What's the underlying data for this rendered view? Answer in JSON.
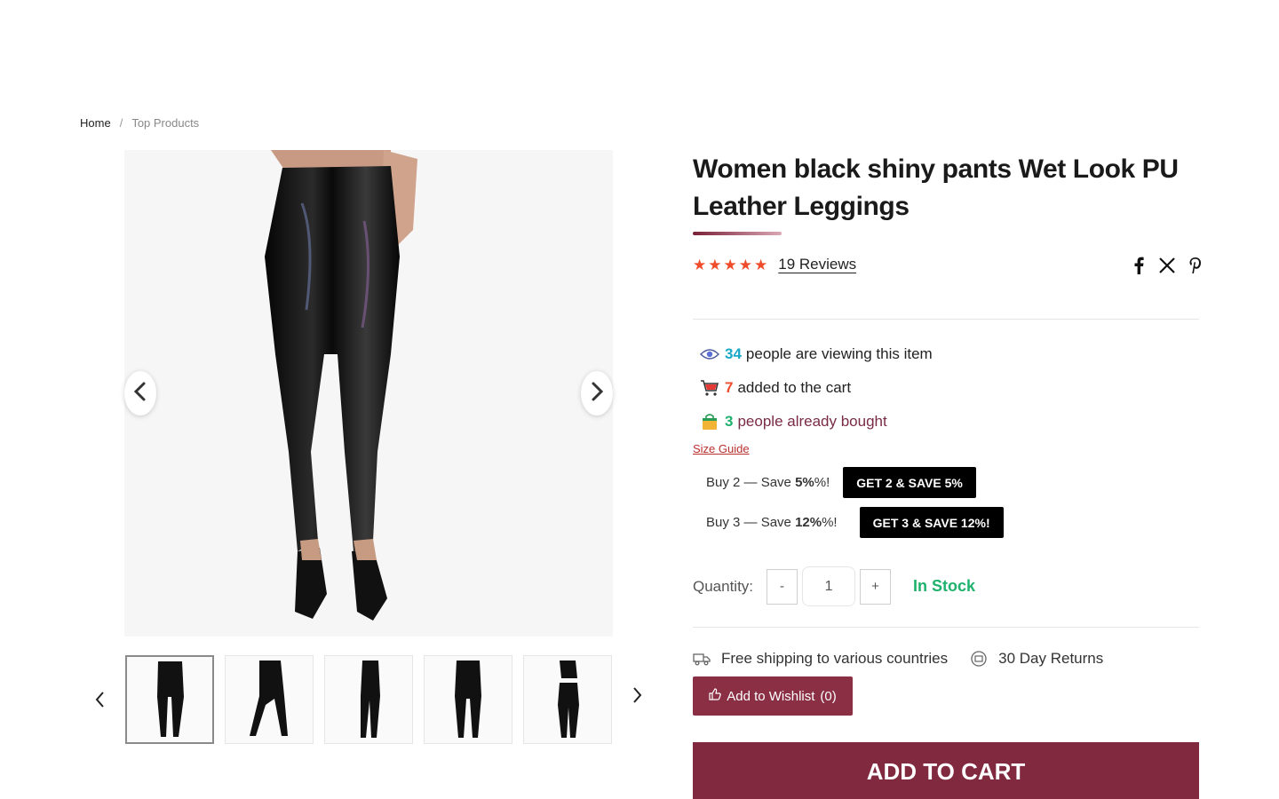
{
  "breadcrumb": {
    "home": "Home",
    "separator": "/",
    "current": "Top Products"
  },
  "product": {
    "title": "Women black shiny pants Wet Look PU Leather Leggings",
    "rating": 5,
    "reviews_label": "19 Reviews"
  },
  "share": {
    "icons": [
      "facebook-icon",
      "x-icon",
      "pinterest-icon"
    ]
  },
  "stats": {
    "viewing": {
      "count": "34",
      "text": "people are viewing this item",
      "color": "#1aa7c9"
    },
    "cart": {
      "count": "7",
      "text": "added to the cart",
      "color": "#f04c2b"
    },
    "bought": {
      "count": "3",
      "text": "people already bought",
      "color": "#1fb26d",
      "text_color": "#7a2b45"
    }
  },
  "size_guide": " Size Guide",
  "bundles": [
    {
      "label_prefix": "Buy 2 — Save ",
      "pct": "5%",
      "label_suffix": "%!",
      "button": "GET 2 & SAVE 5%"
    },
    {
      "label_prefix": "Buy 3 — Save ",
      "pct": "12%",
      "label_suffix": "%!",
      "button": "GET 3 & SAVE 12%!"
    }
  ],
  "quantity": {
    "label": "Quantity:",
    "minus": "-",
    "value": "1",
    "plus": "+",
    "stock": "In Stock"
  },
  "perks": {
    "shipping": "Free shipping to various countries",
    "returns": "30 Day Returns"
  },
  "wishlist": {
    "label": "Add to Wishlist",
    "count": "(0)"
  },
  "cart_button": "ADD TO CART",
  "colors": {
    "brand": "#80293f",
    "accent": "#f04c2b",
    "stock": "#1fb26d"
  }
}
